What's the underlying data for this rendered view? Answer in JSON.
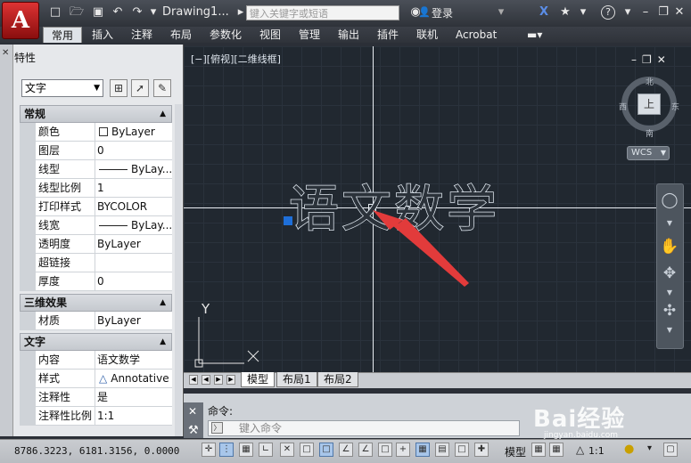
{
  "app": {
    "logo_letter": "A",
    "drawing_title": "Drawing1...",
    "search_placeholder": "键入关键字或短语",
    "login_label": "登录",
    "help_label": "?"
  },
  "ribbon_tabs": [
    "常用",
    "插入",
    "注释",
    "布局",
    "参数化",
    "视图",
    "管理",
    "输出",
    "插件",
    "联机",
    "Acrobat"
  ],
  "palette": {
    "title": "特性",
    "object_type": "文字",
    "sections": [
      {
        "name": "常规",
        "rows": [
          {
            "label": "颜色",
            "value": "ByLayer",
            "kind": "swatch"
          },
          {
            "label": "图层",
            "value": "0"
          },
          {
            "label": "线型",
            "value": "ByLay...",
            "kind": "line"
          },
          {
            "label": "线型比例",
            "value": "1"
          },
          {
            "label": "打印样式",
            "value": "BYCOLOR"
          },
          {
            "label": "线宽",
            "value": "ByLay...",
            "kind": "line"
          },
          {
            "label": "透明度",
            "value": "ByLayer"
          },
          {
            "label": "超链接",
            "value": ""
          },
          {
            "label": "厚度",
            "value": "0"
          }
        ]
      },
      {
        "name": "三维效果",
        "rows": [
          {
            "label": "材质",
            "value": "ByLayer"
          }
        ]
      },
      {
        "name": "文字",
        "rows": [
          {
            "label": "内容",
            "value": "语文数学"
          },
          {
            "label": "样式",
            "value": "Annotative",
            "kind": "anno"
          },
          {
            "label": "注释性",
            "value": "是"
          },
          {
            "label": "注释性比例",
            "value": "1:1"
          }
        ]
      }
    ]
  },
  "viewport": {
    "label": "[−][俯视][二维线框]",
    "mtext": "语文数学",
    "ucs_y": "Y",
    "viewcube": {
      "top": "上",
      "north": "北",
      "south": "南",
      "east": "东",
      "west": "西",
      "coord_menu": "WCS"
    }
  },
  "layout_tabs": [
    "模型",
    "布局1",
    "布局2"
  ],
  "command": {
    "label": "命令:",
    "placeholder": "键入命令"
  },
  "status": {
    "coords": "8786.3223,  6181.3156, 0.0000",
    "model_label": "模型",
    "scale": "1:1"
  },
  "watermark": {
    "text": "Bai经验",
    "sub": "jingyan.baidu.com"
  },
  "colors": {
    "accent": "#1e6fd9",
    "viewport_bg": "#212830",
    "arrow": "#e23b3b"
  }
}
